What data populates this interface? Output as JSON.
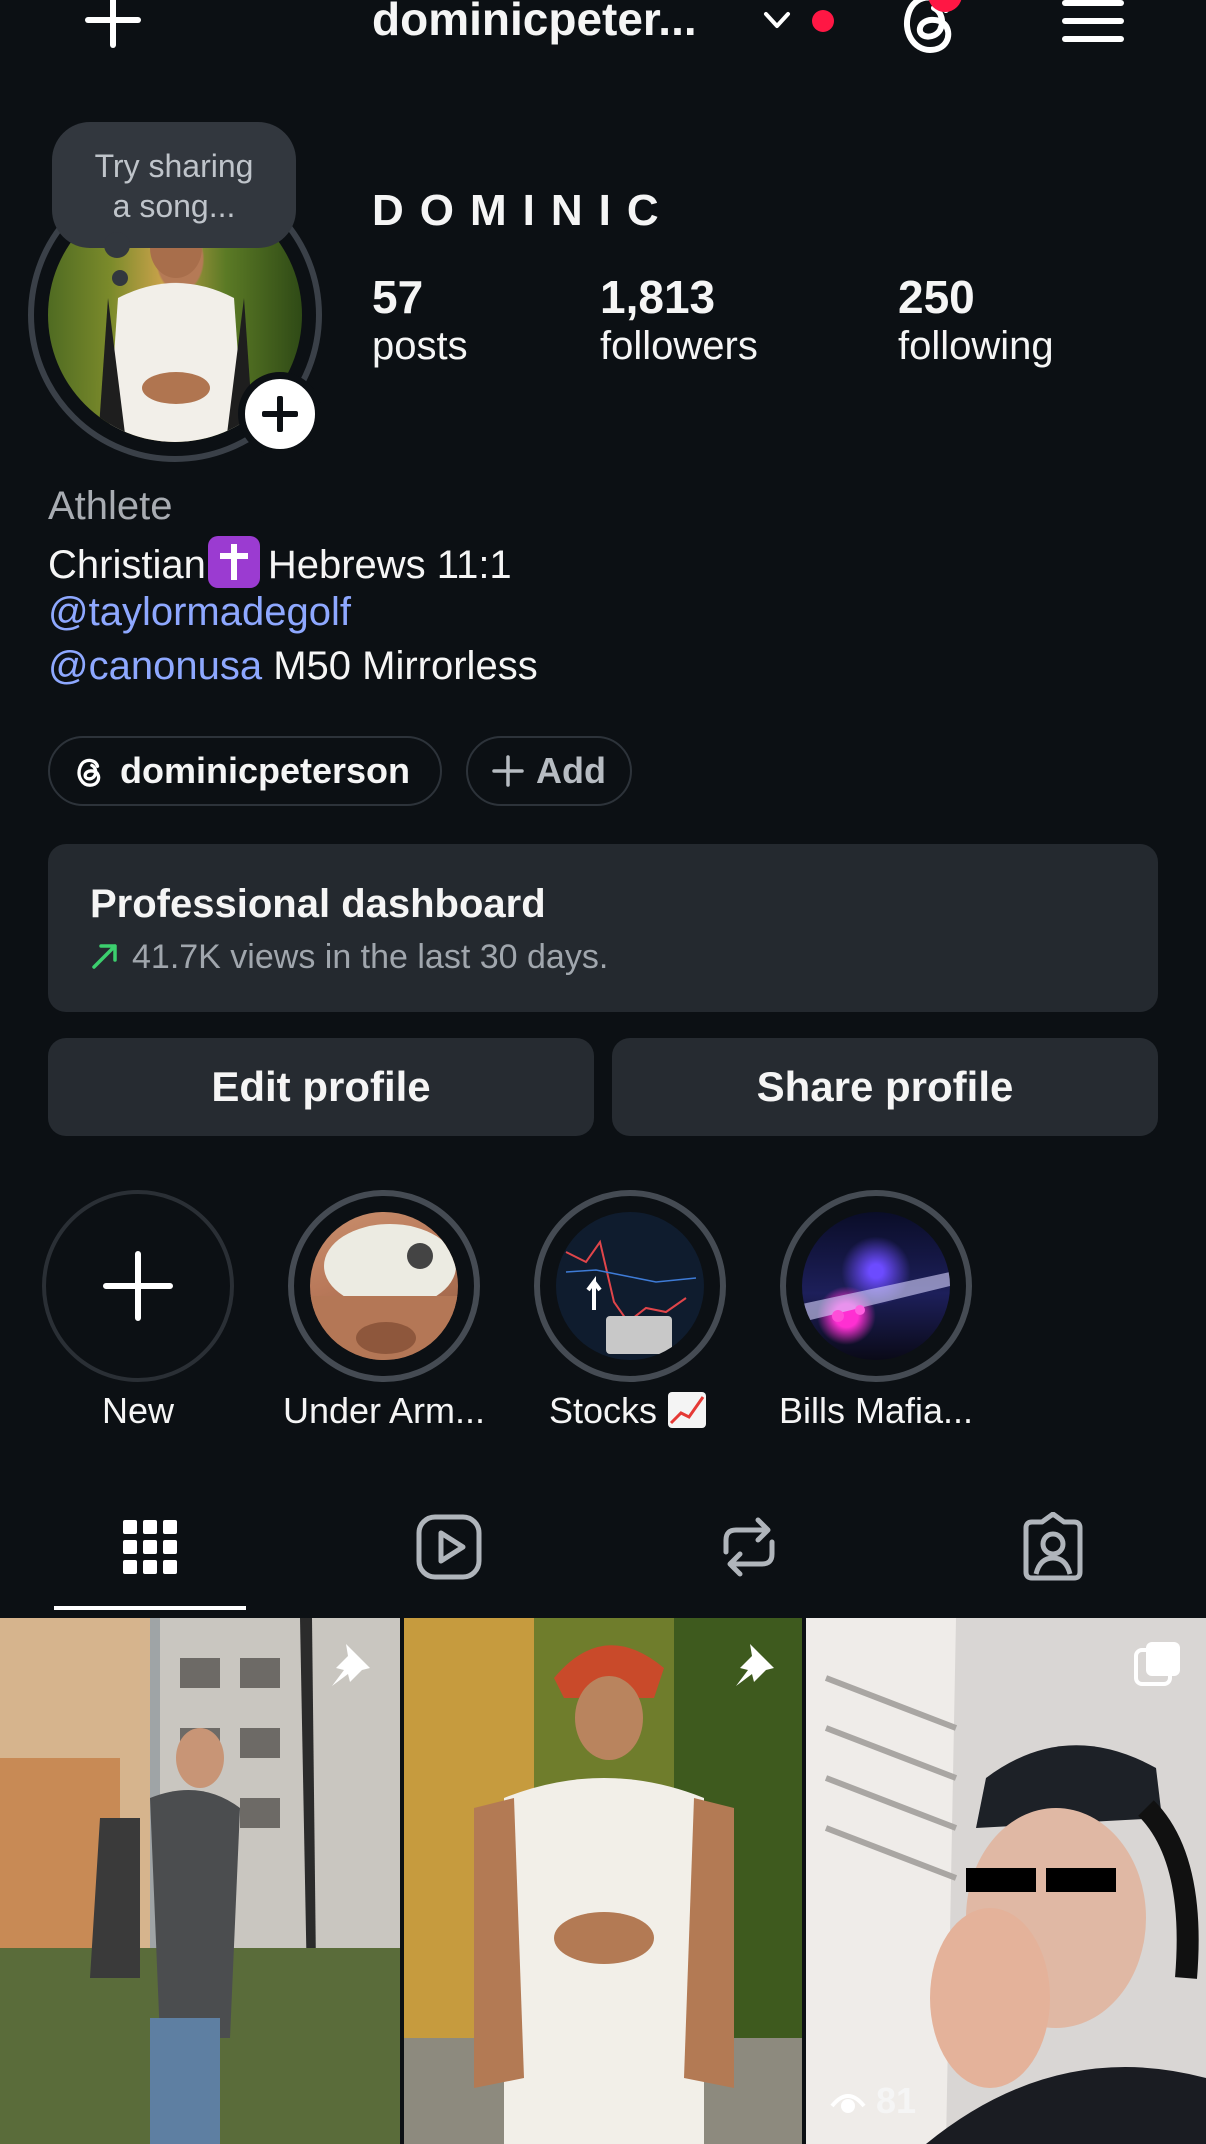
{
  "header": {
    "username": "dominicpeter...",
    "create_icon": "plus-icon",
    "account_switch_icon": "chevron-down-icon",
    "threads_icon": "threads-icon",
    "menu_icon": "hamburger-menu-icon"
  },
  "note": {
    "text_line1": "Try sharing",
    "text_line2": "a song..."
  },
  "profile": {
    "display_name": "DOMINIC",
    "stats": [
      {
        "value": "57",
        "label": "posts"
      },
      {
        "value": "1,813",
        "label": "followers"
      },
      {
        "value": "250",
        "label": "following"
      }
    ],
    "category": "Athlete",
    "bio": {
      "line1_text": "Christian",
      "line1_suffix": "Hebrews 11:1",
      "line2_link": "@taylormadegolf",
      "line3_link": "@canonusa",
      "line3_text": "M50 Mirrorless"
    },
    "threads_handle": "dominicpeterson",
    "add_label": "Add"
  },
  "dashboard": {
    "title": "Professional dashboard",
    "subtitle": "41.7K views in the last 30 days.",
    "trend_color": "#3ccf6e"
  },
  "buttons": {
    "edit": "Edit profile",
    "share": "Share profile"
  },
  "highlights": [
    {
      "label": "New",
      "icon": "plus-icon"
    },
    {
      "label": "Under Arm..."
    },
    {
      "label": "Stocks"
    },
    {
      "label": "Bills Mafia..."
    }
  ],
  "tabs": [
    {
      "name": "posts",
      "icon": "grid-icon",
      "selected": true
    },
    {
      "name": "reels",
      "icon": "reels-icon"
    },
    {
      "name": "reposts",
      "icon": "repost-icon"
    },
    {
      "name": "tagged",
      "icon": "tagged-user-icon"
    }
  ],
  "posts": [
    {
      "pinned": true,
      "icon": "pin-icon"
    },
    {
      "pinned": true,
      "icon": "pin-icon"
    },
    {
      "pinned": false,
      "icon": "multi-post-icon",
      "views": "81"
    }
  ],
  "colors": {
    "background": "#0c1014",
    "link": "#8ea8ff",
    "notification": "#ff1744"
  }
}
